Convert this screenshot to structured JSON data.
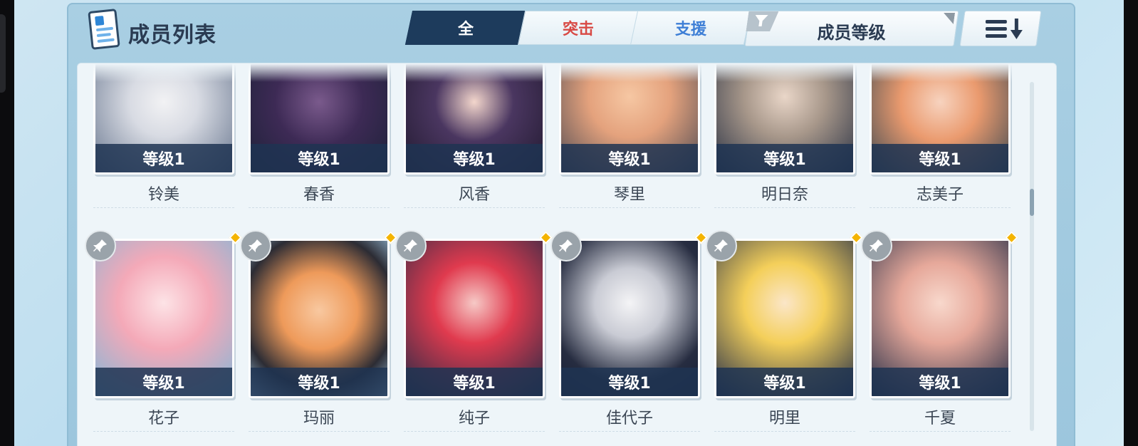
{
  "header": {
    "title": "成员列表",
    "tabs": [
      {
        "label": "全",
        "active": true
      },
      {
        "label": "突击",
        "active": false
      },
      {
        "label": "支援",
        "active": false
      }
    ],
    "sort_label": "成员等级"
  },
  "colors": {
    "accent_navy": "#1d3b5c",
    "striker_red": "#d84a45",
    "special_blue": "#3e7fd6",
    "new_badge": "#f4b400"
  },
  "members_row1": [
    {
      "name": "铃美",
      "level": "等级1"
    },
    {
      "name": "春香",
      "level": "等级1"
    },
    {
      "name": "风香",
      "level": "等级1"
    },
    {
      "name": "琴里",
      "level": "等级1"
    },
    {
      "name": "明日奈",
      "level": "等级1"
    },
    {
      "name": "志美子",
      "level": "等级1"
    }
  ],
  "members_row2": [
    {
      "name": "花子",
      "level": "等级1",
      "pin_icon": "pin-icon",
      "new_badge": true
    },
    {
      "name": "玛丽",
      "level": "等级1",
      "pin_icon": "pin-icon",
      "new_badge": true
    },
    {
      "name": "纯子",
      "level": "等级1",
      "pin_icon": "pin-icon",
      "new_badge": true
    },
    {
      "name": "佳代子",
      "level": "等级1",
      "pin_icon": "pin-icon",
      "new_badge": true
    },
    {
      "name": "明里",
      "level": "等级1",
      "pin_icon": "pin-icon",
      "new_badge": true
    },
    {
      "name": "千夏",
      "level": "等级1",
      "pin_icon": "pin-icon",
      "new_badge": true
    }
  ],
  "icons": {
    "title": "member-list-icon",
    "filter": "filter-icon",
    "sort_order": "sort-order-icon"
  }
}
